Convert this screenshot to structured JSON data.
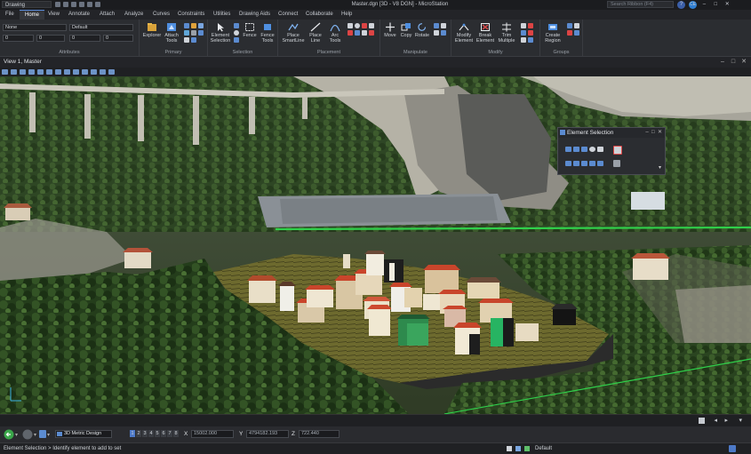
{
  "titlebar": {
    "workflow": "Drawing",
    "title": "Master.dgn [3D - V8 DGN] - MicroStation",
    "search_placeholder": "Search Ribbon (F4)",
    "user_initials": "CE"
  },
  "menu": [
    "File",
    "Home",
    "View",
    "Annotate",
    "Attach",
    "Analyze",
    "Curves",
    "Constraints",
    "Utilities",
    "Drawing Aids",
    "Connect",
    "Collaborate",
    "Help"
  ],
  "ribbon": {
    "attributes": {
      "level": "None",
      "style": "Default",
      "weight": "0",
      "color": "0",
      "label": "Attributes"
    },
    "primary": {
      "explorer": "Explorer",
      "attach_tools": "Attach Tools",
      "label": "Primary"
    },
    "selection": {
      "element_selection": "Element Selection",
      "fence": "Fence",
      "fence_tools": "Fence Tools",
      "label": "Selection"
    },
    "placement": {
      "place_smartline": "Place SmartLine",
      "place_line": "Place Line",
      "arc": "Arc Tools",
      "label": "Placement"
    },
    "manipulate": {
      "move": "Move",
      "copy": "Copy",
      "rotate": "Rotate",
      "label": "Manipulate"
    },
    "modify": {
      "modify_element": "Modify Element",
      "break_element": "Break Element",
      "trim_multiple": "Trim Multiple",
      "label": "Modify"
    },
    "groups": {
      "create_region": "Create Region",
      "label": "Groups"
    }
  },
  "view": {
    "title": "View 1, Master"
  },
  "element_selection": {
    "title": "Element Selection"
  },
  "status": {
    "model": "3D Metric Design",
    "view_numbers": [
      "1",
      "2",
      "3",
      "4",
      "5",
      "6",
      "7",
      "8"
    ],
    "x_label": "X",
    "x_value": "15002.000",
    "y_label": "Y",
    "y_value": "4794182.193",
    "z_label": "Z",
    "z_value": "722.440",
    "prompt": "Element Selection > Identify element to add to set",
    "level_text": "Default"
  },
  "colors": {
    "accent": "#5a8ad8",
    "ribbon_bg": "#2b2d31",
    "chrome_bg": "#1e1f22"
  }
}
